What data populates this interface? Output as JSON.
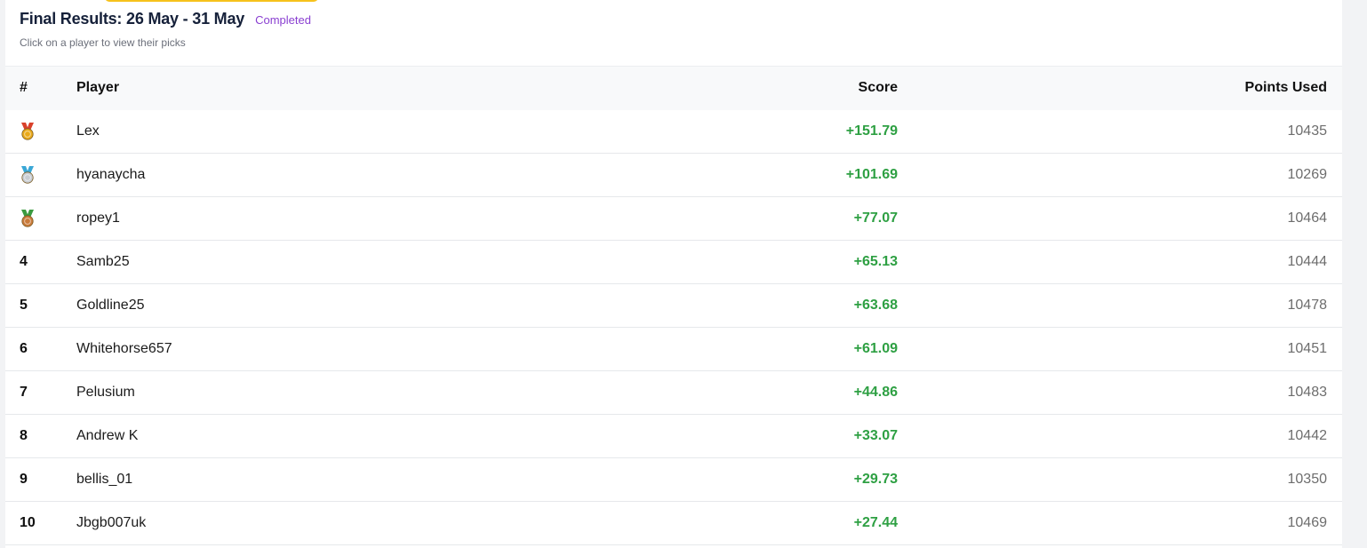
{
  "header": {
    "title": "Final Results: 26 May - 31 May",
    "status": "Completed",
    "subtitle": "Click on a player to view their picks"
  },
  "table": {
    "columns": {
      "rank": "#",
      "player": "Player",
      "score": "Score",
      "points": "Points Used"
    },
    "rows": [
      {
        "rank": "",
        "medal": "gold-medal-icon",
        "player": "Lex",
        "score": "+151.79",
        "points": "10435"
      },
      {
        "rank": "",
        "medal": "silver-medal-icon",
        "player": "hyanaycha",
        "score": "+101.69",
        "points": "10269"
      },
      {
        "rank": "",
        "medal": "bronze-medal-icon",
        "player": "ropey1",
        "score": "+77.07",
        "points": "10464"
      },
      {
        "rank": "4",
        "player": "Samb25",
        "score": "+65.13",
        "points": "10444"
      },
      {
        "rank": "5",
        "player": "Goldline25",
        "score": "+63.68",
        "points": "10478"
      },
      {
        "rank": "6",
        "player": "Whitehorse657",
        "score": "+61.09",
        "points": "10451"
      },
      {
        "rank": "7",
        "player": "Pelusium",
        "score": "+44.86",
        "points": "10483"
      },
      {
        "rank": "8",
        "player": "Andrew K",
        "score": "+33.07",
        "points": "10442"
      },
      {
        "rank": "9",
        "player": "bellis_01",
        "score": "+29.73",
        "points": "10350"
      },
      {
        "rank": "10",
        "player": "Jbgb007uk",
        "score": "+27.44",
        "points": "10469"
      }
    ]
  },
  "colors": {
    "accent_yellow": "#f6c21c",
    "status_purple": "#8a3fd1",
    "score_green": "#2ea043",
    "gold": "#e9a91a",
    "silver": "#c8cdd3",
    "bronze": "#c97a3a",
    "ribbon_red": "#d9412b",
    "ribbon_blue": "#3aa7d6",
    "ribbon_green": "#3a9a3f"
  }
}
